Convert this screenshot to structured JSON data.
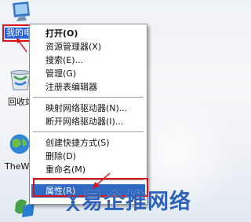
{
  "desktop": {
    "icons": [
      {
        "name": "my-computer",
        "label": "我的电脑"
      },
      {
        "name": "recycle-bin",
        "label": "回收站"
      },
      {
        "name": "theworld-browser",
        "label": "TheWorld"
      },
      {
        "name": "bottom-shortcut",
        "label": ""
      }
    ]
  },
  "context_menu": {
    "items": [
      {
        "label": "打开(O)",
        "bold": true
      },
      {
        "label": "资源管理器(X)"
      },
      {
        "label": "搜索(E)..."
      },
      {
        "label": "管理(G)"
      },
      {
        "label": "注册表编辑器"
      },
      {
        "label": "映射网络驱动器(N)..."
      },
      {
        "label": "断开网络驱动器(I)..."
      },
      {
        "label": "创建快捷方式(S)"
      },
      {
        "label": "删除(D)"
      },
      {
        "label": "重命名(M)"
      },
      {
        "label": "属性(R)",
        "highlighted": true
      }
    ]
  },
  "watermark": {
    "text": "易企推网络"
  },
  "colors": {
    "selection": "#316ac5",
    "annotation_red": "#d8141c",
    "watermark_blue": "#2e62b8"
  }
}
